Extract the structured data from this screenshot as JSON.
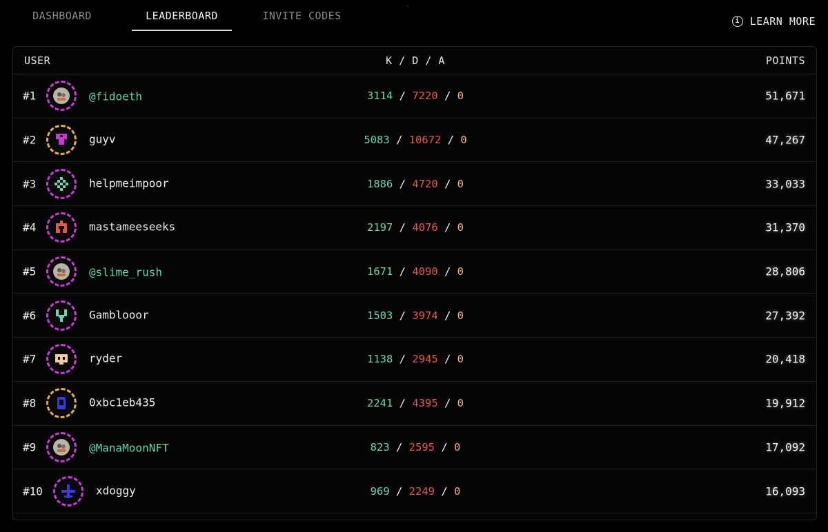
{
  "nav": {
    "tabs": [
      {
        "label": "DASHBOARD"
      },
      {
        "label": "LEADERBOARD"
      },
      {
        "label": "INVITE CODES"
      }
    ],
    "active_tab": "LEADERBOARD",
    "learn_more": "LEARN MORE",
    "info_icon": "i"
  },
  "table": {
    "headers": {
      "user": "USER",
      "kda": "K / D / A",
      "points": "POINTS"
    },
    "rows": [
      {
        "rank": "#1",
        "user": "@fidoeth",
        "k": "3114",
        "d": "7220",
        "a": "0",
        "points": "51,671",
        "avatar_icon": "photo-avatar-icon",
        "avatar_color": "#c93ad8"
      },
      {
        "rank": "#2",
        "user": "guyv",
        "k": "5083",
        "d": "10672",
        "a": "0",
        "points": "47,267",
        "avatar_icon": "pixel-mushroom-icon",
        "avatar_color": "#e3b23c"
      },
      {
        "rank": "#3",
        "user": "helpmeimpoor",
        "k": "1886",
        "d": "4720",
        "a": "0",
        "points": "33,033",
        "avatar_icon": "pixel-diamond-icon",
        "avatar_color": "#c93ad8"
      },
      {
        "rank": "#4",
        "user": "mastameeseeks",
        "k": "2197",
        "d": "4076",
        "a": "0",
        "points": "31,370",
        "avatar_icon": "pixel-robot-icon",
        "avatar_color": "#c93ad8"
      },
      {
        "rank": "#5",
        "user": "@slime_rush",
        "k": "1671",
        "d": "4090",
        "a": "0",
        "points": "28,806",
        "avatar_icon": "photo-avatar-icon",
        "avatar_color": "#c93ad8"
      },
      {
        "rank": "#6",
        "user": "Gamblooor",
        "k": "1503",
        "d": "3974",
        "a": "0",
        "points": "27,392",
        "avatar_icon": "pixel-fork-icon",
        "avatar_color": "#c93ad8"
      },
      {
        "rank": "#7",
        "user": "ryder",
        "k": "1138",
        "d": "2945",
        "a": "0",
        "points": "20,418",
        "avatar_icon": "pixel-mask-icon",
        "avatar_color": "#c93ad8"
      },
      {
        "rank": "#8",
        "user": "0xbc1eb435",
        "k": "2241",
        "d": "4395",
        "a": "0",
        "points": "19,912",
        "avatar_icon": "pixel-capsule-icon",
        "avatar_color": "#e3b23c"
      },
      {
        "rank": "#9",
        "user": "@ManaMoonNFT",
        "k": "823",
        "d": "2595",
        "a": "0",
        "points": "17,092",
        "avatar_icon": "photo-avatar-icon",
        "avatar_color": "#c93ad8"
      },
      {
        "rank": "#10",
        "user": "xdoggy",
        "k": "969",
        "d": "2249",
        "a": "0",
        "points": "16,093",
        "avatar_icon": "pixel-plane-icon",
        "avatar_color": "#c93ad8"
      }
    ]
  },
  "colors": {
    "kills": "#69d4b6",
    "deaths": "#e8584a",
    "assists": "#f0b48a",
    "linked_user": "#5fd6b4",
    "avatar_ring_purple": "#c93ad8",
    "avatar_ring_gold": "#e3b23c"
  }
}
